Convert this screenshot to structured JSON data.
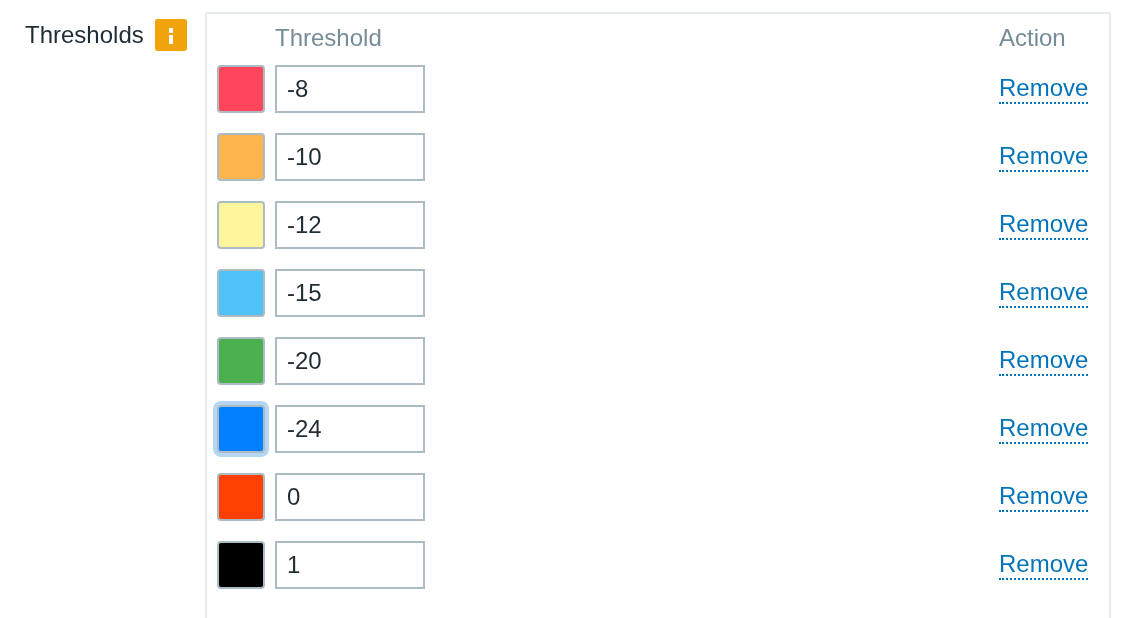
{
  "field": {
    "label": "Thresholds"
  },
  "thresholds": {
    "header": {
      "threshold": "Threshold",
      "action": "Action"
    },
    "rows": [
      {
        "color": "#ff465c",
        "value": "-8",
        "focused": false,
        "action": "Remove"
      },
      {
        "color": "#ffb54d",
        "value": "-10",
        "focused": false,
        "action": "Remove"
      },
      {
        "color": "#fff59d",
        "value": "-12",
        "focused": false,
        "action": "Remove"
      },
      {
        "color": "#4fc3f7",
        "value": "-15",
        "focused": false,
        "action": "Remove"
      },
      {
        "color": "#4caf50",
        "value": "-20",
        "focused": false,
        "action": "Remove"
      },
      {
        "color": "#0080ff",
        "value": "-24",
        "focused": true,
        "action": "Remove"
      },
      {
        "color": "#ff4000",
        "value": "0",
        "focused": false,
        "action": "Remove"
      },
      {
        "color": "#000000",
        "value": "1",
        "focused": false,
        "action": "Remove"
      }
    ]
  }
}
